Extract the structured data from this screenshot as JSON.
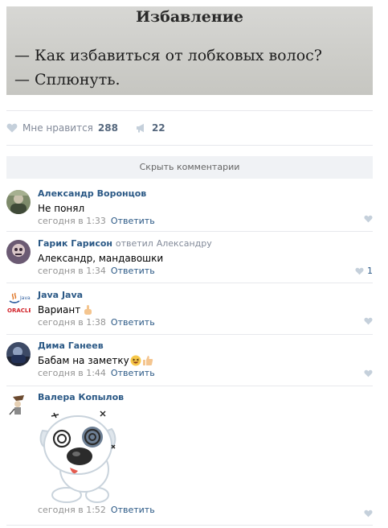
{
  "post": {
    "image": {
      "title": "Избавление",
      "line1": "— Как избавиться от лобковых волос?",
      "line2": "— Сплюнуть."
    },
    "likes_label": "Мне нравится",
    "likes_count": "288",
    "shares_count": "22",
    "hide_comments_label": "Скрыть комментарии"
  },
  "comments": [
    {
      "author": "Александр Воронцов",
      "text": "Не понял",
      "time": "сегодня в 1:33",
      "reply_label": "Ответить",
      "likes": ""
    },
    {
      "author": "Гарик Гарисон",
      "reply_prefix": "ответил",
      "reply_to": "Александру",
      "text": "Александр, мандавошки",
      "time": "сегодня в 1:34",
      "reply_label": "Ответить",
      "likes": "1"
    },
    {
      "author": "Java Java",
      "text": "Вариант",
      "time": "сегодня в 1:38",
      "reply_label": "Ответить",
      "likes": ""
    },
    {
      "author": "Дима Ганеев",
      "text": "Бабам на заметку",
      "time": "сегодня в 1:44",
      "reply_label": "Ответить",
      "likes": ""
    },
    {
      "author": "Валера Копылов",
      "text": "",
      "time": "сегодня в 1:52",
      "reply_label": "Ответить",
      "likes": ""
    }
  ],
  "avatars": {
    "java_logo_text": "Java",
    "java_logo_brand": "ORACLE"
  },
  "colors": {
    "link": "#2a5885",
    "muted": "#939393",
    "heart": "#c5d0db",
    "bar_bg": "#f0f2f5"
  }
}
